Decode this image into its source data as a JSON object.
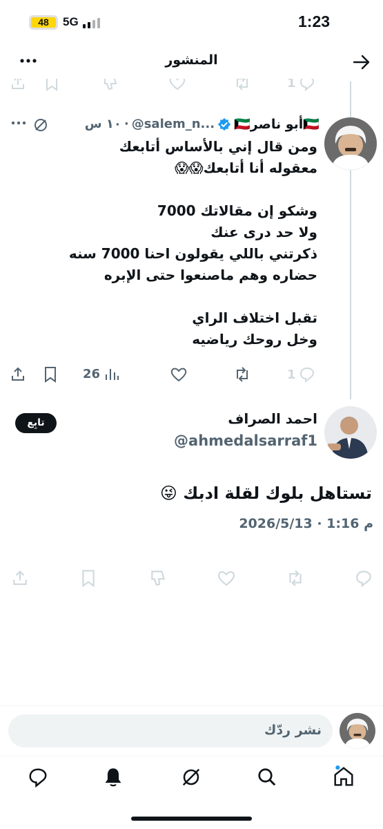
{
  "status_bar": {
    "time": "1:23",
    "battery": "48",
    "network": "5G"
  },
  "header": {
    "title": "المنشور"
  },
  "parent_tweet": {
    "display_name": "🇰🇼أبو ناصر🇰🇼",
    "handle": "@salem_n...",
    "time_ago": "١٠ س",
    "text": "ومن قال إني بالأساس أتابعك\nمعقوله أنا أتابعك😱😱\n\nوشكو إن مقالاتك 7000\nولا حد درى عنك\nذكرتني باللي يقولون احنا 7000 سنه\nحضاره وهم ماصنعوا حتى الإبره\n\nتقبل اختلاف الراي\nوخل روحك رياضيه",
    "reply_count": "1",
    "view_count": "26"
  },
  "top_partial_row": {
    "reply_count": "1"
  },
  "main_tweet": {
    "display_name": "احمد الصراف",
    "handle": "@ahmedalsarraf1",
    "follow_label": "تابِع",
    "text": "تستاهل بلوك لقلة ادبك 😜",
    "timestamp": "2026/5/13 · 1:16 م"
  },
  "reply_bar": {
    "placeholder": "نشر ردّك"
  },
  "bottom_nav": [
    "home-icon",
    "search-icon",
    "grok-icon",
    "notifications-icon",
    "messages-icon"
  ],
  "colors": {
    "text": "#0f1419",
    "muted": "#536471",
    "icon_muted": "#cfd9de",
    "verified": "#1d9bf0",
    "battery": "#ffd60a"
  }
}
